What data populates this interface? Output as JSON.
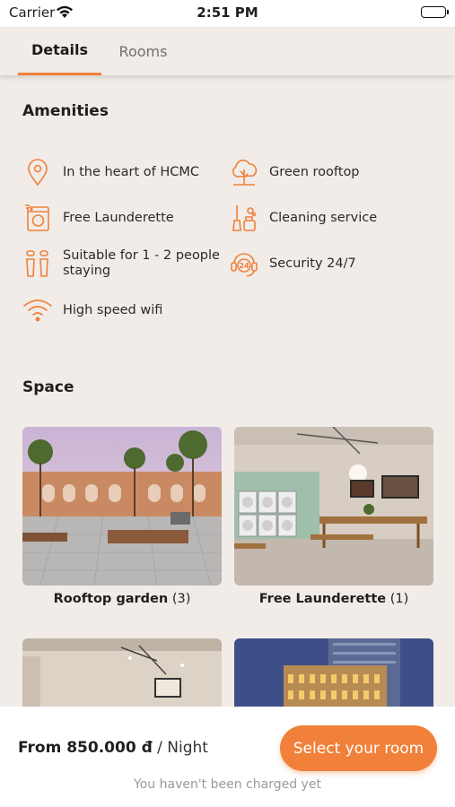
{
  "status_bar": {
    "carrier": "Carrier",
    "time": "2:51 PM"
  },
  "tabs": [
    {
      "label": "Details",
      "active": true
    },
    {
      "label": "Rooms",
      "active": false
    }
  ],
  "amenities": {
    "title": "Amenities",
    "items": [
      {
        "icon": "location-pin-icon",
        "label": "In the heart of HCMC"
      },
      {
        "icon": "tree-icon",
        "label": "Green rooftop"
      },
      {
        "icon": "washing-machine-icon",
        "label": "Free Launderette"
      },
      {
        "icon": "cleaning-broom-icon",
        "label": "Cleaning service"
      },
      {
        "icon": "two-people-icon",
        "label_line1": "Suitable for 1 - 2 people",
        "label_line2": "staying"
      },
      {
        "icon": "security-24-icon",
        "label": "Security 24/7",
        "badge": "24"
      },
      {
        "icon": "wifi-icon",
        "label": "High speed wifi"
      }
    ]
  },
  "space": {
    "title": "Space",
    "cards": [
      {
        "name": "Rooftop garden",
        "count": "(3)",
        "image": "rooftop-garden-photo"
      },
      {
        "name": "Free Launderette",
        "count": "(1)",
        "image": "launderette-photo"
      },
      {
        "name": "",
        "count": "",
        "image": "interior-room-photo"
      },
      {
        "name": "",
        "count": "",
        "image": "building-exterior-photo"
      }
    ]
  },
  "booking": {
    "price": "From 850.000 đ",
    "unit": "/ Night",
    "button": "Select your room",
    "note": "You haven't been charged yet"
  },
  "colors": {
    "accent": "#f0803a",
    "background": "#f1ece8"
  }
}
